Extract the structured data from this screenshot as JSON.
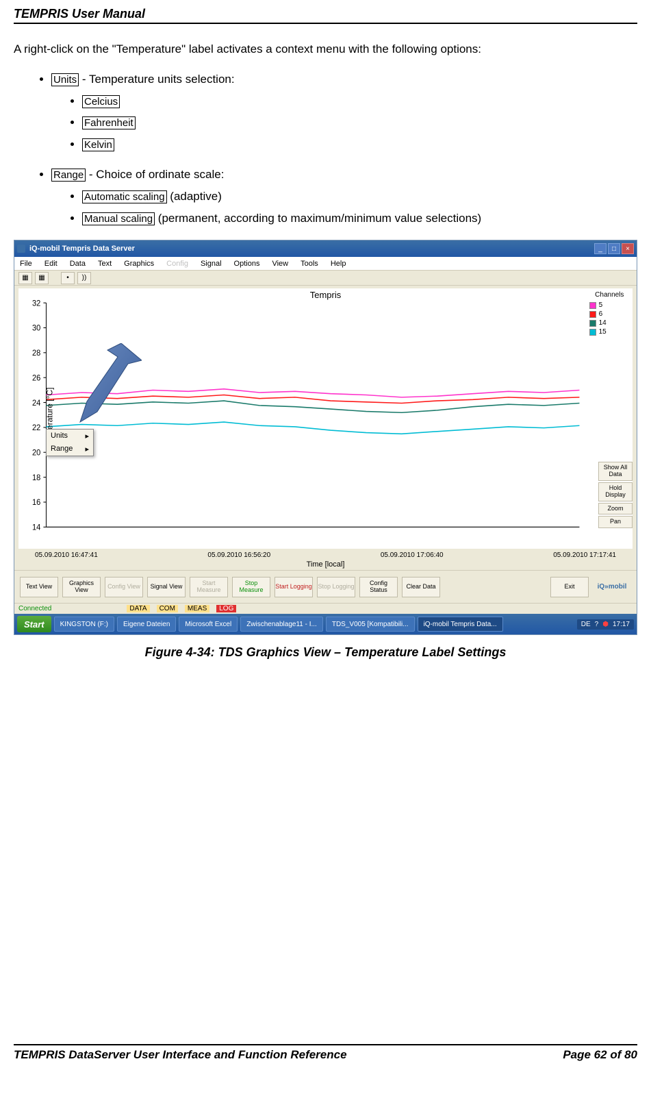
{
  "doc": {
    "header": "TEMPRIS User Manual",
    "intro": "A right-click on the \"Temperature\" label activates a context menu with the following options:",
    "units_label": "Units",
    "units_desc": " - Temperature units selection:",
    "units_items": [
      "Celcius",
      "Fahrenheit",
      "Kelvin"
    ],
    "range_label": "Range",
    "range_desc": " - Choice of ordinate scale:",
    "range_items": [
      {
        "label": "Automatic scaling",
        "desc": " (adaptive)"
      },
      {
        "label": "Manual scaling",
        "desc": " (permanent, according to maximum/minimum value selections)"
      }
    ],
    "figure_caption": "Figure 4-34: TDS Graphics View – Temperature Label Settings",
    "footer_left": "TEMPRIS DataServer User Interface and Function Reference",
    "footer_right": "Page 62 of 80"
  },
  "shot": {
    "window_title": "iQ-mobil Tempris Data Server",
    "menu": [
      "File",
      "Edit",
      "Data",
      "Text",
      "Graphics",
      "Config",
      "Signal",
      "Options",
      "View",
      "Tools",
      "Help"
    ],
    "plot_title": "Tempris",
    "y_label": "Temperature [°C]",
    "y_ticks": [
      "32",
      "30",
      "28",
      "26",
      "24",
      "22",
      "20",
      "18",
      "16",
      "14"
    ],
    "x_ticks": [
      "05.09.2010 16:47:41",
      "05.09.2010 16:56:20",
      "05.09.2010 17:06:40",
      "05.09.2010 17:17:41"
    ],
    "x_label": "Time [local]",
    "channels_title": "Channels",
    "channels": [
      {
        "color": "#ff33cc",
        "id": "5"
      },
      {
        "color": "#ff1a1a",
        "id": "6"
      },
      {
        "color": "#1a7a6a",
        "id": "14"
      },
      {
        "color": "#00bcd4",
        "id": "15"
      }
    ],
    "side_buttons": [
      "Show All Data",
      "Hold Display",
      "Zoom",
      "Pan"
    ],
    "ctx_items": [
      "Units",
      "Range"
    ],
    "bottom_buttons": [
      {
        "t": "Text View",
        "cls": ""
      },
      {
        "t": "Graphics View",
        "cls": ""
      },
      {
        "t": "Config View",
        "cls": "ghost"
      },
      {
        "t": "Signal View",
        "cls": ""
      },
      {
        "t": "Start Measure",
        "cls": "ghost"
      },
      {
        "t": "Stop Measure",
        "cls": "green"
      },
      {
        "t": "Start Logging",
        "cls": "red"
      },
      {
        "t": "Stop Logging",
        "cls": "ghost"
      },
      {
        "t": "Config Status",
        "cls": ""
      },
      {
        "t": "Clear Data",
        "cls": ""
      }
    ],
    "exit": "Exit",
    "status": {
      "conn": "Connected",
      "pills": [
        "DATA",
        "COM",
        "MEAS",
        "LOG"
      ]
    },
    "taskbar": {
      "start": "Start",
      "items": [
        "KINGSTON (F:)",
        "Eigene Dateien",
        "Microsoft Excel",
        "Zwischenablage11 - I...",
        "TDS_V005 [Kompatibili...",
        "iQ-mobil Tempris Data..."
      ],
      "tray_lang": "DE",
      "tray_time": "17:17"
    }
  },
  "chart_data": {
    "type": "line",
    "title": "Tempris",
    "xlabel": "Time [local]",
    "ylabel": "Temperature [°C]",
    "ylim": [
      14,
      33
    ],
    "x_ticks": [
      "05.09.2010 16:47:41",
      "05.09.2010 16:56:20",
      "05.09.2010 17:06:40",
      "05.09.2010 17:17:41"
    ],
    "series": [
      {
        "name": "5",
        "color": "#ff33cc",
        "values": [
          25.2,
          25.4,
          25.3,
          25.6,
          25.5,
          25.7,
          25.4,
          25.5,
          25.3,
          25.2,
          25.0,
          25.1,
          25.3,
          25.5,
          25.4,
          25.6
        ]
      },
      {
        "name": "6",
        "color": "#ff1a1a",
        "values": [
          24.8,
          25.0,
          24.9,
          25.1,
          25.0,
          25.2,
          24.9,
          25.0,
          24.7,
          24.6,
          24.5,
          24.7,
          24.8,
          25.0,
          24.9,
          25.0
        ]
      },
      {
        "name": "14",
        "color": "#1a7a6a",
        "values": [
          24.3,
          24.5,
          24.4,
          24.6,
          24.5,
          24.7,
          24.3,
          24.2,
          24.0,
          23.8,
          23.7,
          23.9,
          24.2,
          24.4,
          24.3,
          24.5
        ]
      },
      {
        "name": "15",
        "color": "#00bcd4",
        "values": [
          22.5,
          22.7,
          22.6,
          22.8,
          22.7,
          22.9,
          22.6,
          22.5,
          22.2,
          22.0,
          21.9,
          22.1,
          22.3,
          22.5,
          22.4,
          22.6
        ]
      }
    ]
  }
}
